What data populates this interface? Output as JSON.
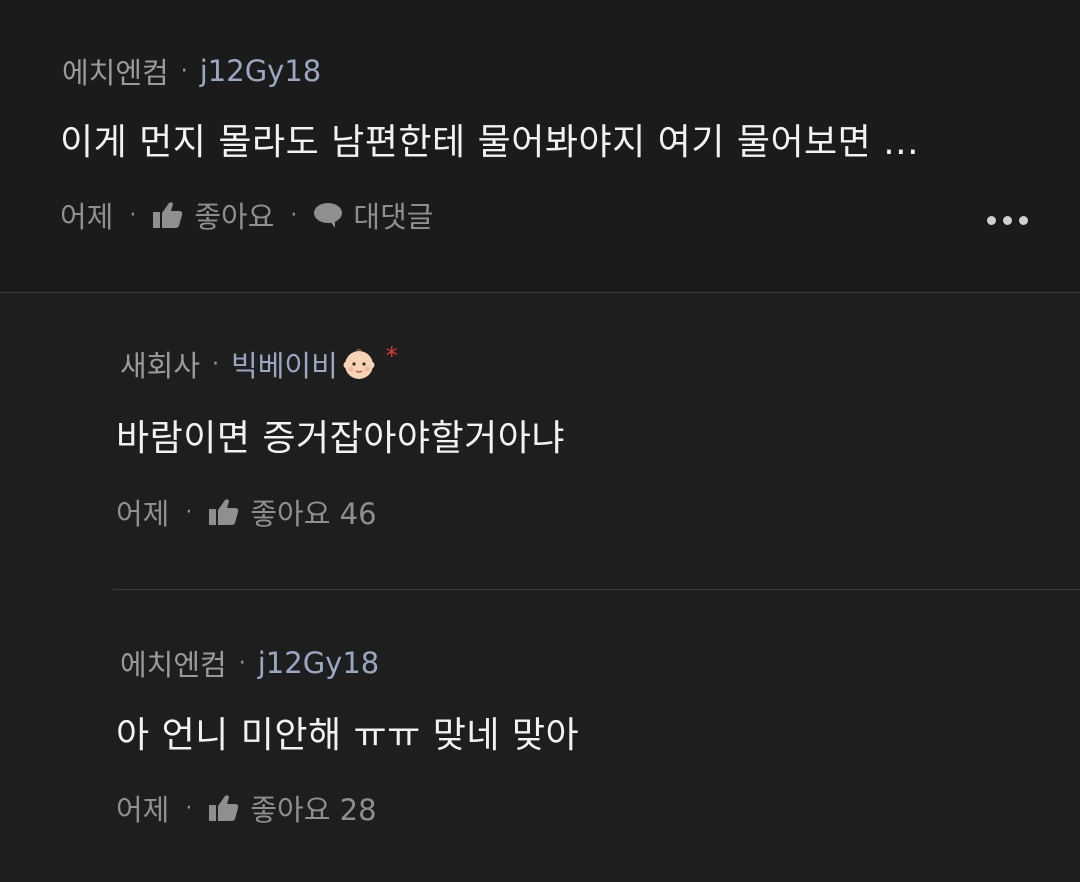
{
  "comments": [
    {
      "group": "에치엔컴",
      "nickname": "j12Gy18",
      "text": "이게 먼지 몰라도 남편한테 물어봐야지 여기 물어보면 ...",
      "time": "어제",
      "like_label": "좋아요",
      "reply_label": "대댓글",
      "more_icon": "more-horizontal-icon"
    },
    {
      "group": "새회사",
      "nickname": "빅베이비",
      "badge_icon": "baby-emoji-icon",
      "author_mark": "*",
      "text": "바람이면 증거잡아야할거아냐",
      "time": "어제",
      "like_label": "좋아요 46"
    },
    {
      "group": "에치엔컴",
      "nickname": "j12Gy18",
      "text": "아 언니 미안해 ㅠㅠ 맞네 맞아",
      "time": "어제",
      "like_label": "좋아요 28"
    }
  ],
  "separator": "·",
  "colors": {
    "background": "#1e1e1e",
    "top_background": "#1b1b1b",
    "nickname": "#9aa7c2",
    "meta": "#9a9a9a",
    "star": "#e23a3a"
  }
}
